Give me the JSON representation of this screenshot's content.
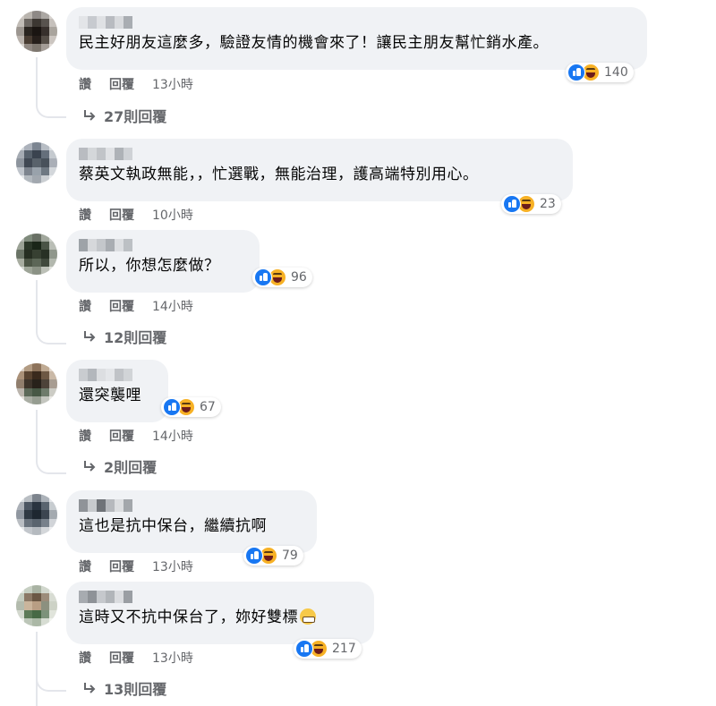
{
  "comments": [
    {
      "text": "民主好朋友這麼多，驗證友情的機會來了！讓民主朋友幫忙銷水產。",
      "reaction_count": "140",
      "like_label": "讚",
      "reply_label": "回覆",
      "time": "13小時",
      "replies_label": "27則回覆",
      "reaction_icons": [
        "like-icon",
        "haha-icon"
      ]
    },
    {
      "text": "蔡英文執政無能，，忙選戰，無能治理，護高端特別用心。",
      "reaction_count": "23",
      "like_label": "讚",
      "reply_label": "回覆",
      "time": "10小時",
      "reaction_icons": [
        "like-icon",
        "haha-icon"
      ]
    },
    {
      "text": "所以，你想怎麼做？",
      "reaction_count": "96",
      "like_label": "讚",
      "reply_label": "回覆",
      "time": "14小時",
      "replies_label": "12則回覆",
      "reaction_icons": [
        "like-icon",
        "haha-icon"
      ]
    },
    {
      "text": "還突襲哩",
      "reaction_count": "67",
      "like_label": "讚",
      "reply_label": "回覆",
      "time": "14小時",
      "replies_label": "2則回覆",
      "reaction_icons": [
        "like-icon",
        "haha-icon"
      ]
    },
    {
      "text": "這也是抗中保台，繼續抗啊",
      "reaction_count": "79",
      "like_label": "讚",
      "reply_label": "回覆",
      "time": "13小時",
      "reaction_icons": [
        "like-icon",
        "haha-icon"
      ]
    },
    {
      "text": "這時又不抗中保台了，妳好雙標",
      "text_emoji": "grimacing-emoji-icon",
      "reaction_count": "217",
      "like_label": "讚",
      "reply_label": "回覆",
      "time": "13小時",
      "replies_label": "13則回覆",
      "reaction_icons": [
        "like-icon",
        "haha-icon"
      ]
    }
  ],
  "colors": {
    "bubble": "#f0f2f5",
    "meta_text": "#65676b",
    "like_blue": "#1877f2",
    "haha_yellow": "#f7b125"
  }
}
